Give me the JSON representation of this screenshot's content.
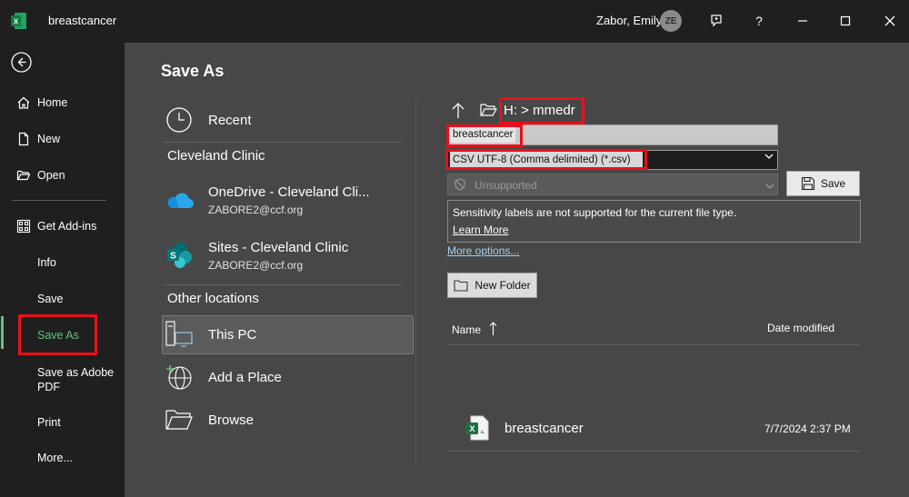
{
  "titlebar": {
    "doc_title": "breastcancer",
    "user_name": "Zabor, Emily",
    "avatar_initials": "ZE",
    "help_label": "?"
  },
  "rail": {
    "items": [
      {
        "label": "Home",
        "icon": "home-icon"
      },
      {
        "label": "New",
        "icon": "new-document-icon"
      },
      {
        "label": "Open",
        "icon": "folder-open-icon"
      },
      {
        "label": "Get Add-ins",
        "icon": "add-ins-icon"
      },
      {
        "label": "Info"
      },
      {
        "label": "Save"
      },
      {
        "label": "Save As"
      },
      {
        "label": "Save as Adobe PDF",
        "line1": "Save as Adobe",
        "line2": "PDF"
      },
      {
        "label": "Print"
      },
      {
        "label": "More..."
      }
    ],
    "active": "Save As",
    "active_color": "#64c380"
  },
  "main": {
    "title": "Save As",
    "locations": {
      "recent": "Recent",
      "org_heading": "Cleveland Clinic",
      "onedrive": {
        "title": "OneDrive - Cleveland Cli...",
        "sub": "ZABORE2@ccf.org"
      },
      "sites": {
        "title": "Sites - Cleveland Clinic",
        "sub": "ZABORE2@ccf.org"
      },
      "other_heading": "Other locations",
      "this_pc": "This PC",
      "add_place": "Add a Place",
      "browse": "Browse"
    },
    "save_pane": {
      "path": "H: > mmedr",
      "filename": "breastcancer",
      "filetype": "CSV UTF-8 (Comma delimited) (*.csv)",
      "sensitivity": "Unsupported",
      "save_label": "Save",
      "sensitivity_msg": "Sensitivity labels are not supported for the current file type.",
      "learn_more": "Learn More",
      "more_options": "More options...",
      "new_folder": "New Folder",
      "columns": {
        "name": "Name",
        "date": "Date modified"
      },
      "files": [
        {
          "name": "breastcancer",
          "date": "7/7/2024 2:37 PM"
        }
      ]
    }
  },
  "colors": {
    "highlight_box": "#e8101a",
    "rail_bg": "#1f1f1f",
    "main_bg": "#474747",
    "excel_green": "#1d6f42"
  }
}
